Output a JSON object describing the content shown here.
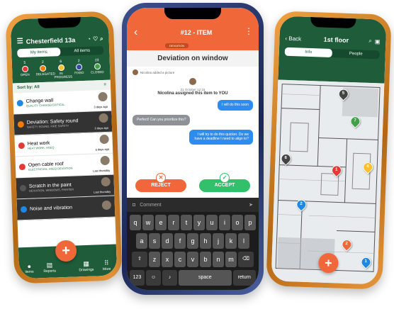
{
  "left_phone": {
    "title": "Chesterfield 13a",
    "tabs": [
      "My items",
      "All items"
    ],
    "stats": [
      {
        "count": "5",
        "label": "OPEN",
        "color": "#e53935"
      },
      {
        "count": "2",
        "label": "DELEGATED",
        "color": "#f57c00"
      },
      {
        "count": "6",
        "label": "IN PROGRESS",
        "color": "#fbc02d"
      },
      {
        "count": "2",
        "label": "FIXED",
        "color": "#3949ab"
      },
      {
        "count": "23",
        "label": "CLOSED",
        "color": "#43a047"
      }
    ],
    "sort_label": "Sort by: All",
    "items": [
      {
        "name": "Change wall",
        "sub": "QUALITY CHANGE/CRITICAL",
        "date": "3 days ago",
        "status_color": "#1e88e5",
        "dark": false
      },
      {
        "name": "Deviation: Safety round",
        "sub": "SAFETY ROUND, FIRE SAFETY",
        "date": "3 days ago",
        "status_color": "#f57c00",
        "dark": true
      },
      {
        "name": "Heat work",
        "sub": "HEAT WORK, HSEQ",
        "date": "a days ago",
        "status_color": "#e53935",
        "dark": false
      },
      {
        "name": "Open cable roof",
        "sub": "ELECTRICIAN, HSEQ DEVIATION",
        "date": "Last thursday",
        "status_color": "#e53935",
        "dark": false
      },
      {
        "name": "Scratch in the paint",
        "sub": "DEVIATION, WINDOWS, PAINTER",
        "date": "Last thursday",
        "status_color": "#555555",
        "dark": true
      },
      {
        "name": "Noise and vibration",
        "sub": "",
        "date": "",
        "status_color": "#1e88e5",
        "dark": true
      }
    ],
    "nav": [
      {
        "icon": "items-icon",
        "label": "Items"
      },
      {
        "icon": "reports-icon",
        "label": "Reports"
      },
      {
        "icon": "drawings-icon",
        "label": "Drawings"
      },
      {
        "icon": "more-icon",
        "label": "More"
      }
    ]
  },
  "middle_phone": {
    "title": "#12 - ITEM",
    "tag": "DEVIATION",
    "subtitle": "Deviation on window",
    "system_note": "Nicolina added a picture",
    "timestamp": "21 October 12:16",
    "assign_text": "Nicolina assigned this item to YOU",
    "messages": [
      {
        "side": "right",
        "text": "I will do this soon"
      },
      {
        "side": "left",
        "text": "Perfect! Can you prioritize this?"
      },
      {
        "side": "right",
        "text": "I will try to do this quicker. Do we have a deadline I need to align to?"
      }
    ],
    "reject_label": "REJECT",
    "accept_label": "ACCEPT",
    "comment_placeholder": "Comment",
    "keyboard": {
      "row1": [
        "q",
        "w",
        "e",
        "r",
        "t",
        "y",
        "u",
        "i",
        "o",
        "p"
      ],
      "row2": [
        "a",
        "s",
        "d",
        "f",
        "g",
        "h",
        "j",
        "k",
        "l"
      ],
      "row3": [
        "z",
        "x",
        "c",
        "v",
        "b",
        "n",
        "m"
      ],
      "num_label": "123",
      "space_label": "space",
      "return_label": "return"
    }
  },
  "right_phone": {
    "back_label": "Back",
    "title": "1st floor",
    "tabs": [
      "Info",
      "People"
    ],
    "pins": [
      {
        "label": "5",
        "color": "#444444"
      },
      {
        "label": "7",
        "color": "#43a047"
      },
      {
        "label": "6",
        "color": "#444444"
      },
      {
        "label": "1",
        "color": "#e53935"
      },
      {
        "label": "4",
        "color": "#fbc02d"
      },
      {
        "label": "2",
        "color": "#1e88e5"
      },
      {
        "label": "2",
        "color": "#f0683a"
      },
      {
        "label": "1",
        "color": "#1e88e5"
      }
    ]
  }
}
